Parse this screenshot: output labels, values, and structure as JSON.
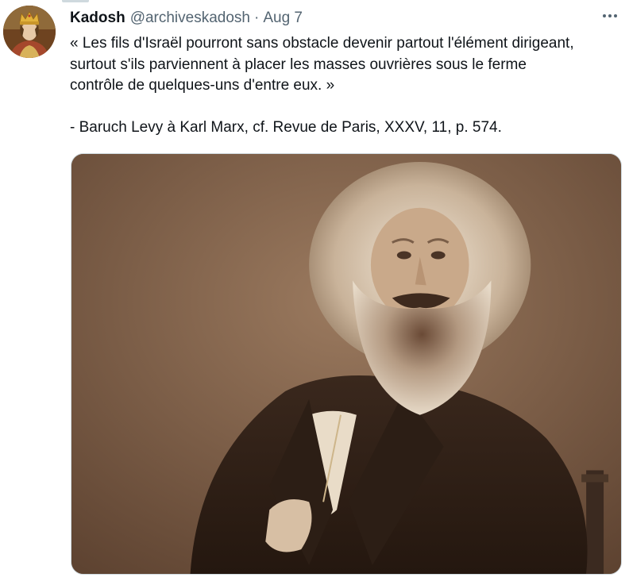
{
  "tweet": {
    "author": {
      "display_name": "Kadosh",
      "handle": "@archiveskadosh",
      "avatar_icon": "crowned-king-avatar-icon"
    },
    "separator": "·",
    "date": "Aug 7",
    "more_icon": "more-horizontal-icon",
    "text_lines": [
      "« Les fils d'Israël pourront sans obstacle devenir partout l'élément dirigeant,",
      "surtout s'ils parviennent à placer les masses ouvrières sous le ferme",
      "contrôle de quelques-uns d'entre eux. »",
      "- Baruch Levy à Karl Marx, cf. Revue de Paris, XXXV, 11, p. 574."
    ],
    "media": {
      "kind": "sepia portrait photograph"
    }
  },
  "colors": {
    "text": "#0f1419",
    "secondary": "#536471",
    "border": "#cfd9de",
    "sepia_bg": "#7b5e48"
  }
}
